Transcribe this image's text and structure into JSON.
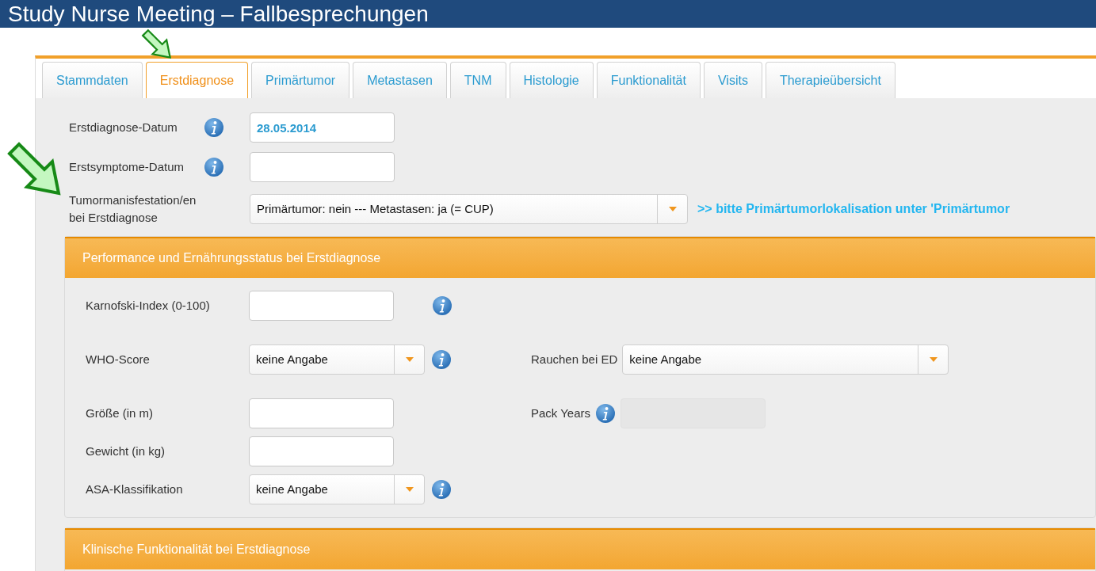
{
  "slide_title": "Study Nurse Meeting – Fallbesprechungen",
  "tabs": [
    {
      "label": "Stammdaten",
      "selected": false
    },
    {
      "label": "Erstdiagnose",
      "selected": true
    },
    {
      "label": "Primärtumor",
      "selected": false
    },
    {
      "label": "Metastasen",
      "selected": false
    },
    {
      "label": "TNM",
      "selected": false
    },
    {
      "label": "Histologie",
      "selected": false
    },
    {
      "label": "Funktionalität",
      "selected": false
    },
    {
      "label": "Visits",
      "selected": false
    },
    {
      "label": "Therapieübersicht",
      "selected": false
    }
  ],
  "top_fields": [
    {
      "kind": "text",
      "label": "Erstdiagnose-Datum",
      "value": "28.05.2014",
      "info": true
    },
    {
      "kind": "text",
      "label": "Erstsymptome-Datum",
      "info": true
    },
    {
      "kind": "select",
      "label": "Tumormanisfestation/en bei Erstdiagnose",
      "value": "Primärtumor: nein --- Metastasen: ja (= CUP)",
      "hint": ">> bitte Primärtumorlokalisation unter 'Primärtumor"
    }
  ],
  "sections": [
    {
      "title": "Performance und Ernährungsstatus bei Erstdiagnose",
      "rows": [
        {
          "left": {
            "kind": "text",
            "label": "Karnofski-Index (0-100)",
            "info": true
          }
        },
        {
          "left": {
            "kind": "select",
            "label": "WHO-Score",
            "value": "keine Angabe",
            "info": true
          },
          "right": {
            "kind": "select",
            "label": "Rauchen bei ED",
            "value": "keine Angabe"
          }
        },
        {
          "left": {
            "kind": "text",
            "label": "Größe (in m)"
          },
          "right": {
            "kind": "text",
            "label": "Pack Years",
            "info": true,
            "disabled": true
          }
        },
        {
          "left": {
            "kind": "text",
            "label": "Gewicht (in kg)"
          }
        },
        {
          "left": {
            "kind": "select",
            "label": "ASA-Klassifikation",
            "value": "keine Angabe",
            "info": true
          }
        }
      ]
    },
    {
      "title": "Klinische Funktionalität bei Erstdiagnose"
    }
  ]
}
